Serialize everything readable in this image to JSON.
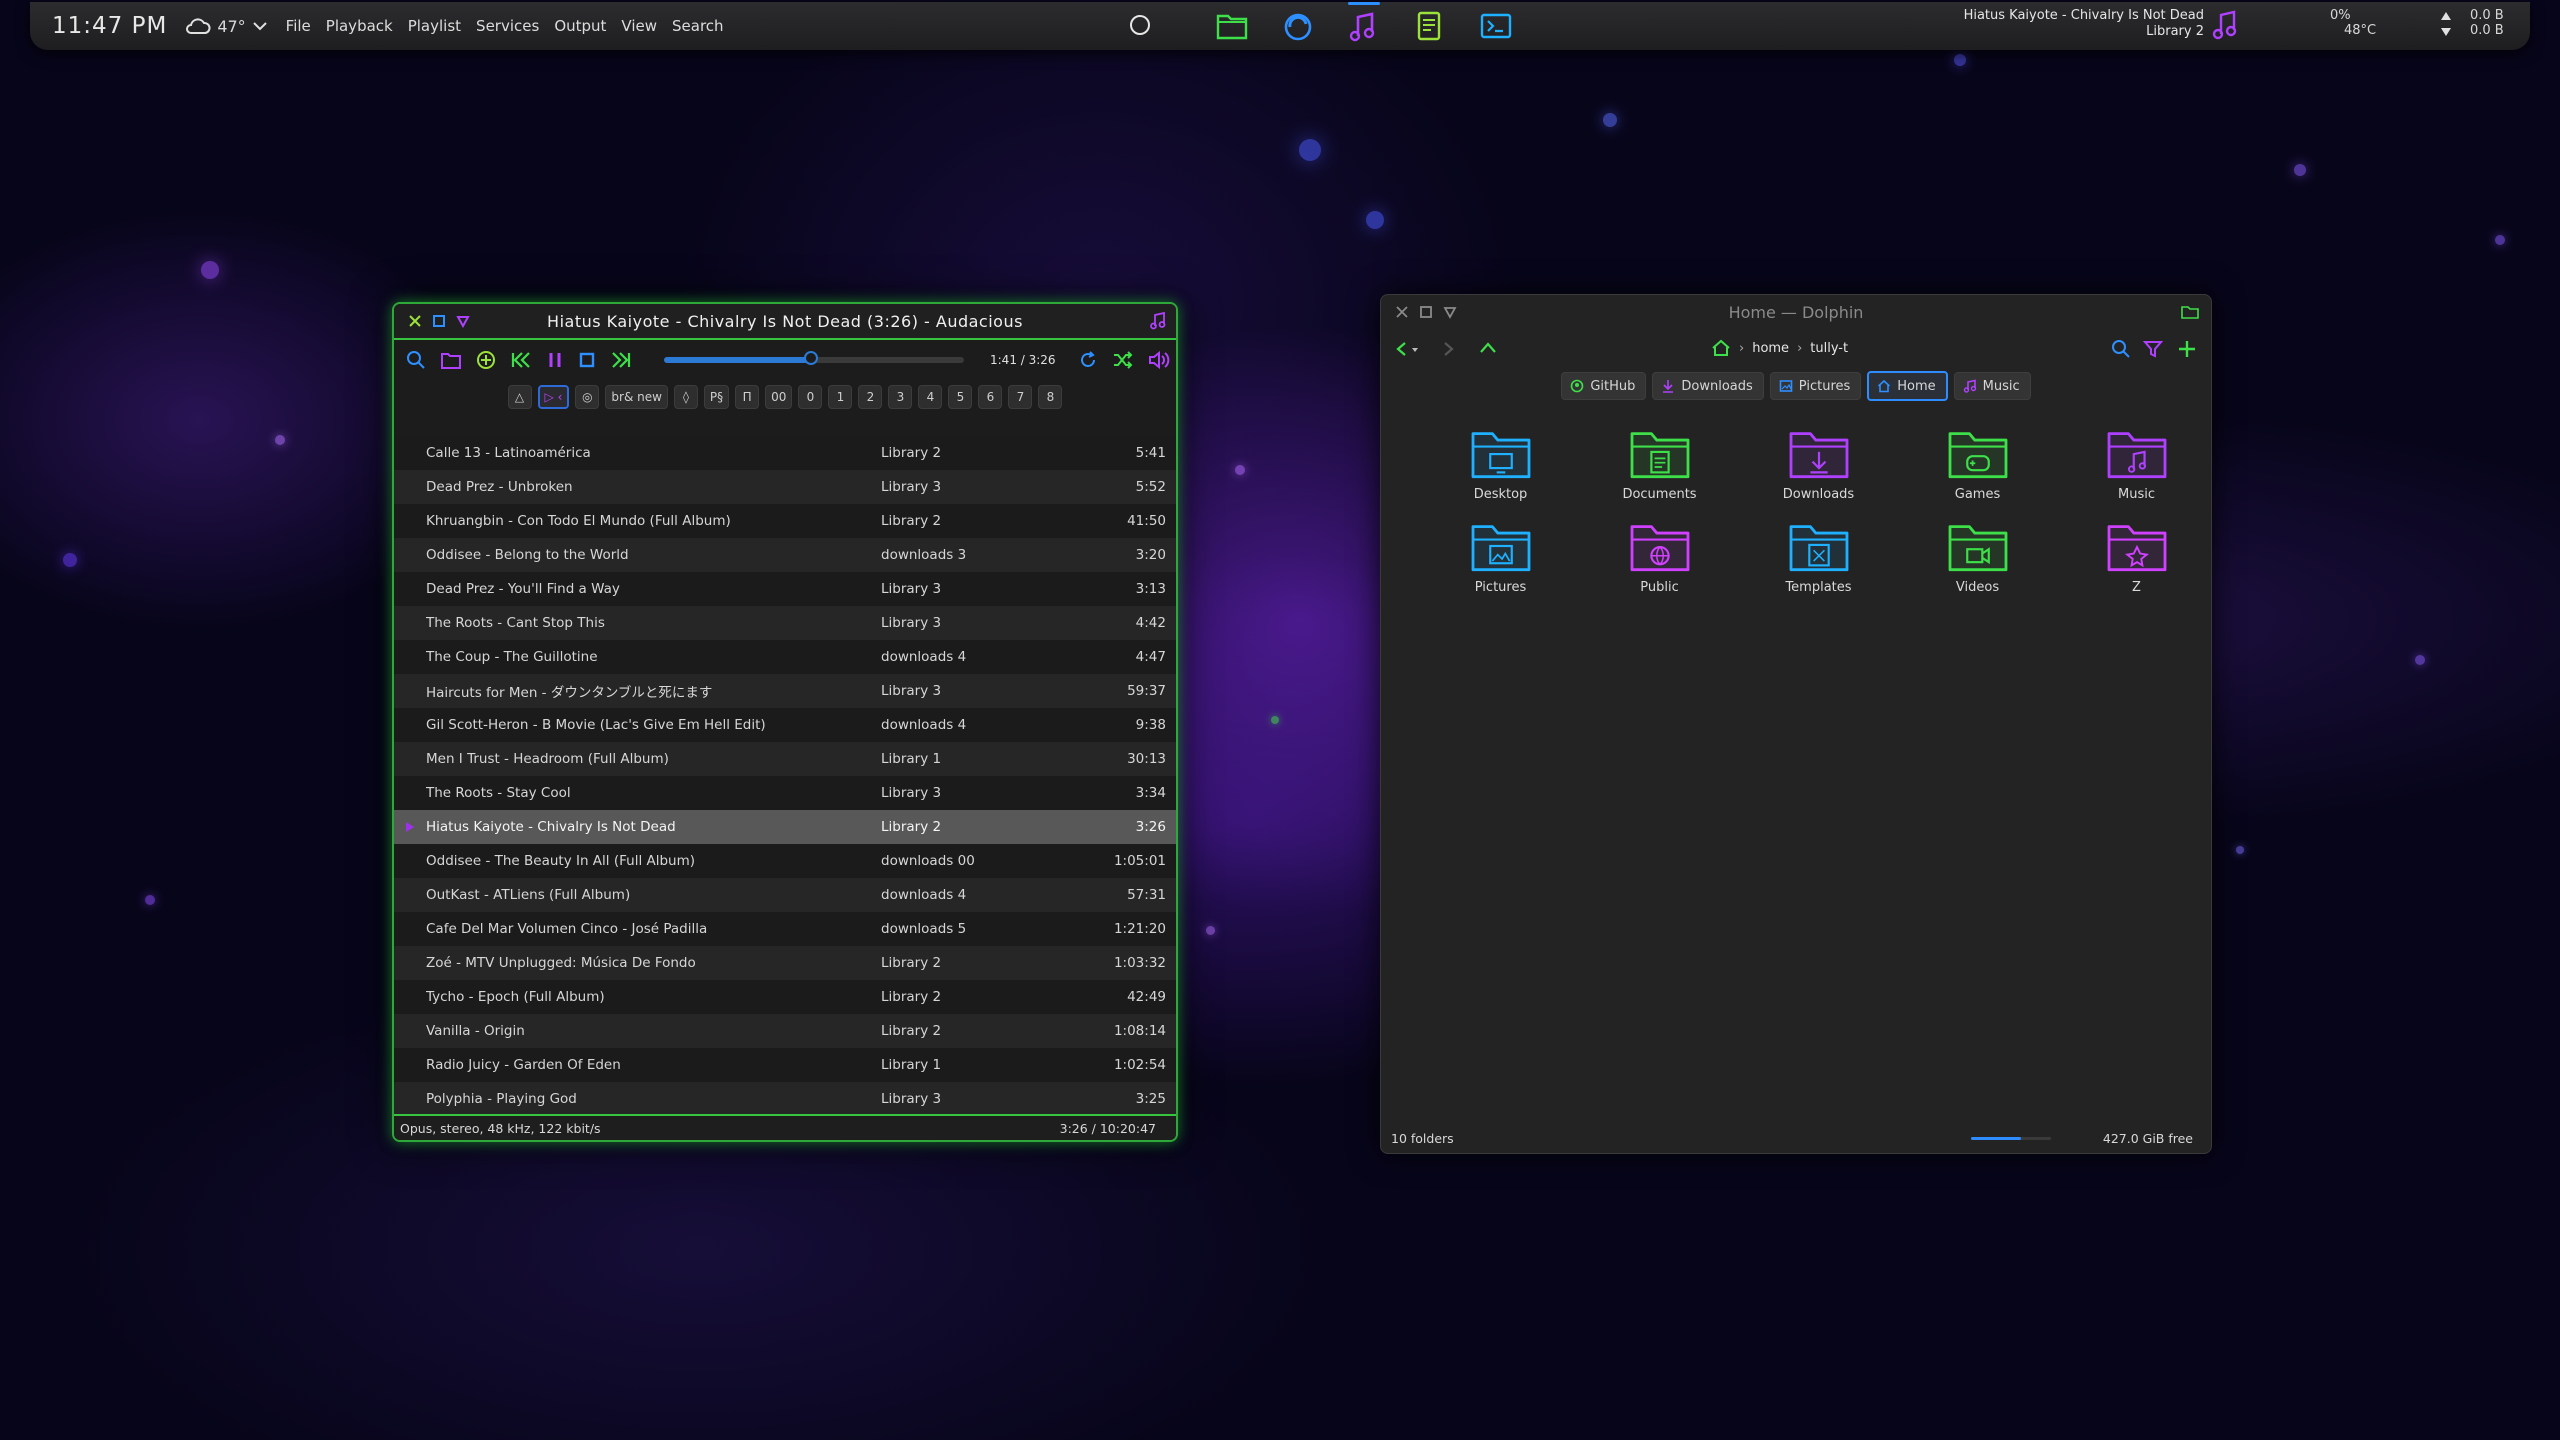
{
  "panel": {
    "clock": "11:47 PM",
    "weather_temp": "47°",
    "menu": [
      "File",
      "Playback",
      "Playlist",
      "Services",
      "Output",
      "View",
      "Search"
    ],
    "tasks": [
      {
        "name": "files-task",
        "icon": "folder-icon",
        "color": "#3ee04a"
      },
      {
        "name": "browser-task",
        "icon": "browser-icon",
        "color": "#2e8fff"
      },
      {
        "name": "music-player-task",
        "icon": "music-note-icon",
        "color": "#b040ff"
      },
      {
        "name": "notes-task",
        "icon": "notes-icon",
        "color": "#9be23a"
      },
      {
        "name": "terminal-task",
        "icon": "terminal-icon",
        "color": "#1fb0ff"
      }
    ],
    "now_playing_title": "Hiatus Kaiyote - Chivalry Is Not Dead",
    "now_playing_album": "Library 2",
    "cpu_percent": "0%",
    "cpu_temp": "48°C",
    "net_up": "0.0 B",
    "net_down": "0.0 B"
  },
  "audacious": {
    "title": "Hiatus Kaiyote - Chivalry Is Not Dead (3:26) - Audacious",
    "time_position": "1:41 / 3:26",
    "seek_fraction": 0.49,
    "playlist_tabs": [
      "△",
      "▷ ‹",
      "◎",
      "br& new",
      "◊",
      "P§",
      "Π",
      "00",
      "0",
      "1",
      "2",
      "3",
      "4",
      "5",
      "6",
      "7",
      "8"
    ],
    "active_tab_index": 1,
    "playing_index": 11,
    "tracks": [
      {
        "title": "Calle 13 - Latinoamérica",
        "album": "Library 2",
        "length": "5:41"
      },
      {
        "title": "Dead Prez - Unbroken",
        "album": "Library 3",
        "length": "5:52"
      },
      {
        "title": "Khruangbin - Con Todo El Mundo (Full Album)",
        "album": "Library 2",
        "length": "41:50"
      },
      {
        "title": "Oddisee - Belong to the World",
        "album": "downloads 3",
        "length": "3:20"
      },
      {
        "title": "Dead Prez - You'll Find a Way",
        "album": "Library 3",
        "length": "3:13"
      },
      {
        "title": "The Roots - Cant Stop This",
        "album": "Library 3",
        "length": "4:42"
      },
      {
        "title": "The Coup - The Guillotine",
        "album": "downloads 4",
        "length": "4:47"
      },
      {
        "title": "Haircuts for Men - ダウンタンブルと死にます",
        "album": "Library 3",
        "length": "59:37"
      },
      {
        "title": "Gil Scott-Heron - B Movie (Lac's Give Em Hell Edit)",
        "album": "downloads 4",
        "length": "9:38"
      },
      {
        "title": "Men I Trust - Headroom (Full Album)",
        "album": "Library 1",
        "length": "30:13"
      },
      {
        "title": "The Roots - Stay Cool",
        "album": "Library 3",
        "length": "3:34"
      },
      {
        "title": "Hiatus Kaiyote - Chivalry Is Not Dead",
        "album": "Library 2",
        "length": "3:26"
      },
      {
        "title": "Oddisee - The Beauty In All (Full Album)",
        "album": "downloads 00",
        "length": "1:05:01"
      },
      {
        "title": "OutKast - ATLiens (Full Album)",
        "album": "downloads 4",
        "length": "57:31"
      },
      {
        "title": "Cafe Del Mar Volumen Cinco - José Padilla",
        "album": "downloads 5",
        "length": "1:21:20"
      },
      {
        "title": "Zoé - MTV Unplugged: Música De Fondo",
        "album": "Library 2",
        "length": "1:03:32"
      },
      {
        "title": "Tycho - Epoch (Full Album)",
        "album": "Library 2",
        "length": "42:49"
      },
      {
        "title": "Vanilla - Origin",
        "album": "Library 2",
        "length": "1:08:14"
      },
      {
        "title": "Radio Juicy - Garden Of Eden",
        "album": "Library 1",
        "length": "1:02:54"
      },
      {
        "title": "Polyphia - Playing God",
        "album": "Library 3",
        "length": "3:25"
      }
    ],
    "status_format": "Opus, stereo, 48 kHz, 122 kbit/s",
    "status_total": "3:26 / 10:20:47"
  },
  "dolphin": {
    "title": "Home — Dolphin",
    "breadcrumb": [
      "home",
      "tully-t"
    ],
    "places": [
      {
        "label": "GitHub",
        "icon": "github-icon",
        "color": "#3ee04a"
      },
      {
        "label": "Downloads",
        "icon": "download-icon",
        "color": "#b040ff"
      },
      {
        "label": "Pictures",
        "icon": "picture-icon",
        "color": "#2e8fff"
      },
      {
        "label": "Home",
        "icon": "home-icon",
        "color": "#2e8fff"
      },
      {
        "label": "Music",
        "icon": "music-note-icon",
        "color": "#b040ff"
      }
    ],
    "active_place_index": 3,
    "folders": [
      {
        "label": "Desktop",
        "icon": "desktop-folder-icon",
        "color": "#1fb0ff"
      },
      {
        "label": "Documents",
        "icon": "documents-folder-icon",
        "color": "#3ee04a"
      },
      {
        "label": "Downloads",
        "icon": "downloads-folder-icon",
        "color": "#b040ff"
      },
      {
        "label": "Games",
        "icon": "games-folder-icon",
        "color": "#3ee04a"
      },
      {
        "label": "Music",
        "icon": "music-folder-icon",
        "color": "#b040ff"
      },
      {
        "label": "Pictures",
        "icon": "pictures-folder-icon",
        "color": "#1fb0ff"
      },
      {
        "label": "Public",
        "icon": "public-folder-icon",
        "color": "#d040ff"
      },
      {
        "label": "Templates",
        "icon": "templates-folder-icon",
        "color": "#1fb0ff"
      },
      {
        "label": "Videos",
        "icon": "videos-folder-icon",
        "color": "#3ee04a"
      },
      {
        "label": "Z",
        "icon": "z-folder-icon",
        "color": "#d040ff"
      }
    ],
    "folder_count": "10 folders",
    "free_space": "427.0 GiB free",
    "disk_used_fraction": 0.62
  },
  "colors": {
    "accent_green": "#38c43f",
    "accent_blue": "#2e8fff",
    "accent_purple": "#b040ff"
  }
}
